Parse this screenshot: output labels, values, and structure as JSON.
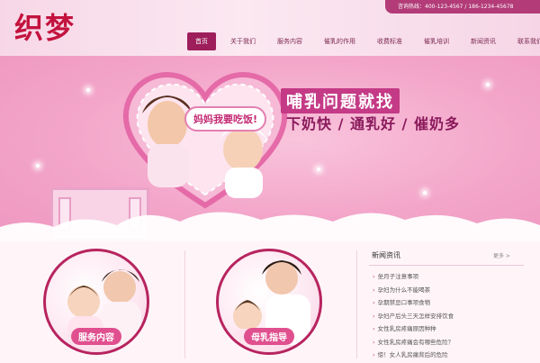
{
  "header": {
    "logo": "织梦",
    "hotline": "咨询热线：400-123-4567 / 186-1234-45678",
    "nav": [
      "首页",
      "关于我们",
      "服务内容",
      "催乳的作用",
      "收费标准",
      "催乳培训",
      "新闻资讯",
      "联系我们"
    ],
    "active_index": 0
  },
  "banner": {
    "bubble": "妈妈我要吃饭!",
    "headline": "哺乳问题就找",
    "subline": "下奶快 / 通乳好 / 催奶多"
  },
  "services": [
    {
      "label": "服务内容"
    },
    {
      "label": "母乳指导"
    }
  ],
  "news": {
    "title": "新闻资讯",
    "more": "更多 >",
    "items": [
      "坐月子注意事项",
      "孕妇为什么不能喝茶",
      "孕期禁忌口事项食物",
      "孕妇产后头三天怎样安排饮食",
      "女性乳房疼痛原因种种",
      "女性乳房疼痛会有哪些危险？",
      "惊！女人乳房痛背后的危险"
    ]
  },
  "colors": {
    "accent": "#9d1e5b",
    "logo": "#c3123e",
    "banner": "#f3a5c9"
  }
}
